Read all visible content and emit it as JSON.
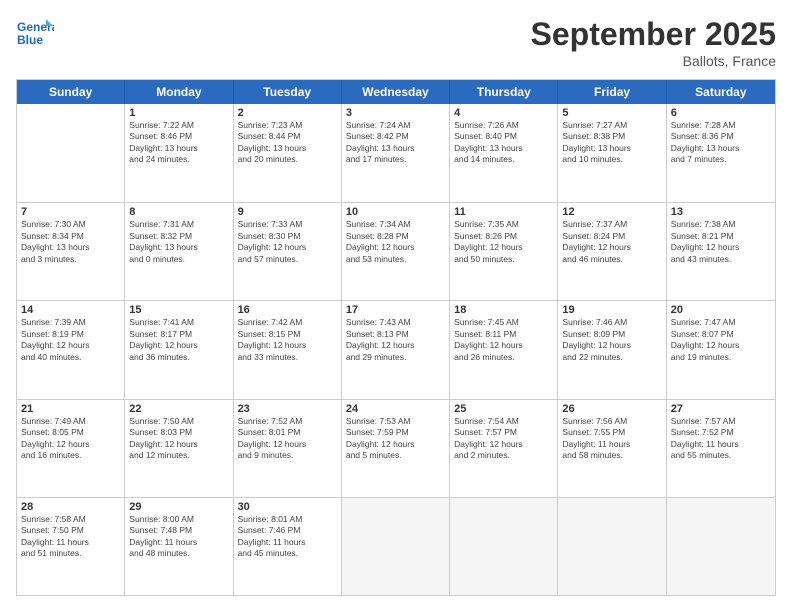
{
  "header": {
    "logo_line1": "General",
    "logo_line2": "Blue",
    "month": "September 2025",
    "location": "Ballots, France"
  },
  "days_of_week": [
    "Sunday",
    "Monday",
    "Tuesday",
    "Wednesday",
    "Thursday",
    "Friday",
    "Saturday"
  ],
  "weeks": [
    [
      {
        "num": "",
        "text": ""
      },
      {
        "num": "1",
        "text": "Sunrise: 7:22 AM\nSunset: 8:46 PM\nDaylight: 13 hours\nand 24 minutes."
      },
      {
        "num": "2",
        "text": "Sunrise: 7:23 AM\nSunset: 8:44 PM\nDaylight: 13 hours\nand 20 minutes."
      },
      {
        "num": "3",
        "text": "Sunrise: 7:24 AM\nSunset: 8:42 PM\nDaylight: 13 hours\nand 17 minutes."
      },
      {
        "num": "4",
        "text": "Sunrise: 7:26 AM\nSunset: 8:40 PM\nDaylight: 13 hours\nand 14 minutes."
      },
      {
        "num": "5",
        "text": "Sunrise: 7:27 AM\nSunset: 8:38 PM\nDaylight: 13 hours\nand 10 minutes."
      },
      {
        "num": "6",
        "text": "Sunrise: 7:28 AM\nSunset: 8:36 PM\nDaylight: 13 hours\nand 7 minutes."
      }
    ],
    [
      {
        "num": "7",
        "text": "Sunrise: 7:30 AM\nSunset: 8:34 PM\nDaylight: 13 hours\nand 3 minutes."
      },
      {
        "num": "8",
        "text": "Sunrise: 7:31 AM\nSunset: 8:32 PM\nDaylight: 13 hours\nand 0 minutes."
      },
      {
        "num": "9",
        "text": "Sunrise: 7:33 AM\nSunset: 8:30 PM\nDaylight: 12 hours\nand 57 minutes."
      },
      {
        "num": "10",
        "text": "Sunrise: 7:34 AM\nSunset: 8:28 PM\nDaylight: 12 hours\nand 53 minutes."
      },
      {
        "num": "11",
        "text": "Sunrise: 7:35 AM\nSunset: 8:26 PM\nDaylight: 12 hours\nand 50 minutes."
      },
      {
        "num": "12",
        "text": "Sunrise: 7:37 AM\nSunset: 8:24 PM\nDaylight: 12 hours\nand 46 minutes."
      },
      {
        "num": "13",
        "text": "Sunrise: 7:38 AM\nSunset: 8:21 PM\nDaylight: 12 hours\nand 43 minutes."
      }
    ],
    [
      {
        "num": "14",
        "text": "Sunrise: 7:39 AM\nSunset: 8:19 PM\nDaylight: 12 hours\nand 40 minutes."
      },
      {
        "num": "15",
        "text": "Sunrise: 7:41 AM\nSunset: 8:17 PM\nDaylight: 12 hours\nand 36 minutes."
      },
      {
        "num": "16",
        "text": "Sunrise: 7:42 AM\nSunset: 8:15 PM\nDaylight: 12 hours\nand 33 minutes."
      },
      {
        "num": "17",
        "text": "Sunrise: 7:43 AM\nSunset: 8:13 PM\nDaylight: 12 hours\nand 29 minutes."
      },
      {
        "num": "18",
        "text": "Sunrise: 7:45 AM\nSunset: 8:11 PM\nDaylight: 12 hours\nand 26 minutes."
      },
      {
        "num": "19",
        "text": "Sunrise: 7:46 AM\nSunset: 8:09 PM\nDaylight: 12 hours\nand 22 minutes."
      },
      {
        "num": "20",
        "text": "Sunrise: 7:47 AM\nSunset: 8:07 PM\nDaylight: 12 hours\nand 19 minutes."
      }
    ],
    [
      {
        "num": "21",
        "text": "Sunrise: 7:49 AM\nSunset: 8:05 PM\nDaylight: 12 hours\nand 16 minutes."
      },
      {
        "num": "22",
        "text": "Sunrise: 7:50 AM\nSunset: 8:03 PM\nDaylight: 12 hours\nand 12 minutes."
      },
      {
        "num": "23",
        "text": "Sunrise: 7:52 AM\nSunset: 8:01 PM\nDaylight: 12 hours\nand 9 minutes."
      },
      {
        "num": "24",
        "text": "Sunrise: 7:53 AM\nSunset: 7:59 PM\nDaylight: 12 hours\nand 5 minutes."
      },
      {
        "num": "25",
        "text": "Sunrise: 7:54 AM\nSunset: 7:57 PM\nDaylight: 12 hours\nand 2 minutes."
      },
      {
        "num": "26",
        "text": "Sunrise: 7:56 AM\nSunset: 7:55 PM\nDaylight: 11 hours\nand 58 minutes."
      },
      {
        "num": "27",
        "text": "Sunrise: 7:57 AM\nSunset: 7:52 PM\nDaylight: 11 hours\nand 55 minutes."
      }
    ],
    [
      {
        "num": "28",
        "text": "Sunrise: 7:58 AM\nSunset: 7:50 PM\nDaylight: 11 hours\nand 51 minutes."
      },
      {
        "num": "29",
        "text": "Sunrise: 8:00 AM\nSunset: 7:48 PM\nDaylight: 11 hours\nand 48 minutes."
      },
      {
        "num": "30",
        "text": "Sunrise: 8:01 AM\nSunset: 7:46 PM\nDaylight: 11 hours\nand 45 minutes."
      },
      {
        "num": "",
        "text": ""
      },
      {
        "num": "",
        "text": ""
      },
      {
        "num": "",
        "text": ""
      },
      {
        "num": "",
        "text": ""
      }
    ]
  ]
}
